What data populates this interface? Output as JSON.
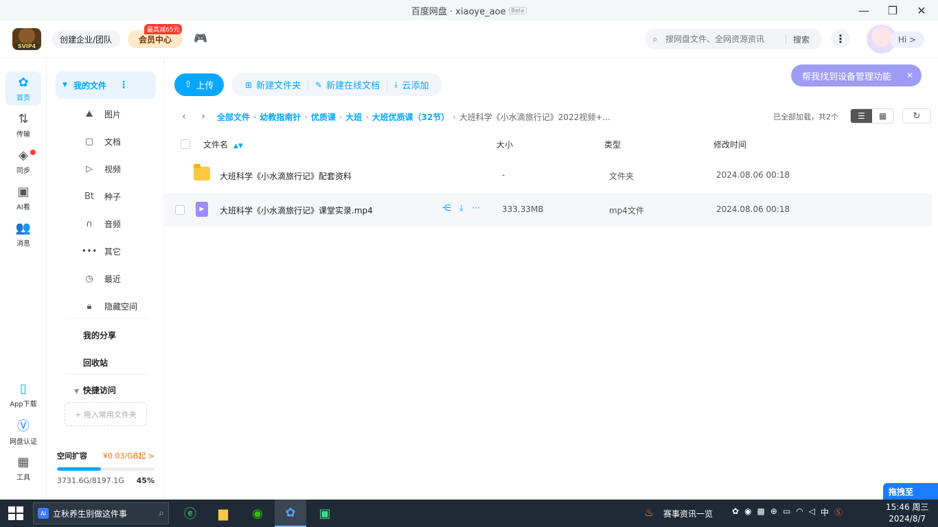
{
  "window": {
    "title": "百度网盘 · xiaoye_aoe",
    "beta": "Beta"
  },
  "header": {
    "logo_text": "SVIP4",
    "team_button": "创建企业/团队",
    "vip_button": "会员中心",
    "vip_badge": "最高减65元",
    "search_placeholder": "搜网盘文件、全网资源资讯",
    "search_button": "搜索",
    "hi_label": "Hi >"
  },
  "rail": [
    {
      "label": "首页"
    },
    {
      "label": "传输"
    },
    {
      "label": "同步"
    },
    {
      "label": "AI看"
    },
    {
      "label": "消息"
    },
    {
      "label": "App下载"
    },
    {
      "label": "网盘认证"
    },
    {
      "label": "工具"
    }
  ],
  "sidebar": {
    "my_files": "我的文件",
    "items": [
      {
        "label": "图片",
        "icon": "image-icon"
      },
      {
        "label": "文档",
        "icon": "document-icon"
      },
      {
        "label": "视频",
        "icon": "video-icon"
      },
      {
        "label": "种子",
        "icon": "torrent-icon"
      },
      {
        "label": "音频",
        "icon": "audio-icon"
      },
      {
        "label": "其它",
        "icon": "more-icon"
      },
      {
        "label": "最近",
        "icon": "clock-icon"
      },
      {
        "label": "隐藏空间",
        "icon": "lock-icon"
      }
    ],
    "my_share": "我的分享",
    "recycle": "回收站",
    "quick_access": "快捷访问",
    "drop_hint": "+ 拖入常用文件夹",
    "space": {
      "label": "空间扩容",
      "price": "¥0.03/GB起 >",
      "usage": "3731.6G/8197.1G",
      "percent": "45%",
      "fill_fraction": 0.45
    }
  },
  "toolbar": {
    "upload": "上传",
    "new_folder": "新建文件夹",
    "new_doc": "新建在线文档",
    "cloud_add": "云添加",
    "assistant": "帮我找到设备管理功能"
  },
  "breadcrumb": [
    "全部文件",
    "幼教指南针",
    "优质课",
    "大班",
    "大班优质课（32节）",
    "大班科学《小水滴旅行记》2022视频+..."
  ],
  "list_status": "已全部加载，共2个",
  "table": {
    "headers": {
      "name": "文件名",
      "size": "大小",
      "type": "类型",
      "modified": "修改时间"
    },
    "rows": [
      {
        "name": "大班科学《小水滴旅行记》配套资料",
        "size": "-",
        "type": "文件夹",
        "modified": "2024.08.06 00:18"
      },
      {
        "name": "大班科学《小水滴旅行记》课堂实录.mp4",
        "size": "333.33MB",
        "type": "mp4文件",
        "modified": "2024.08.06 00:18"
      }
    ]
  },
  "float_button": "拖拽至",
  "taskbar": {
    "search_text": "立秋养生别做这件事",
    "tray_text": "赛事资讯一览",
    "ime": "中",
    "time": "15:46 周三",
    "date": "2024/8/7"
  },
  "colors": {
    "accent": "#06a7ff",
    "assistant": "#9f9cf6",
    "price": "#ff6a00"
  }
}
